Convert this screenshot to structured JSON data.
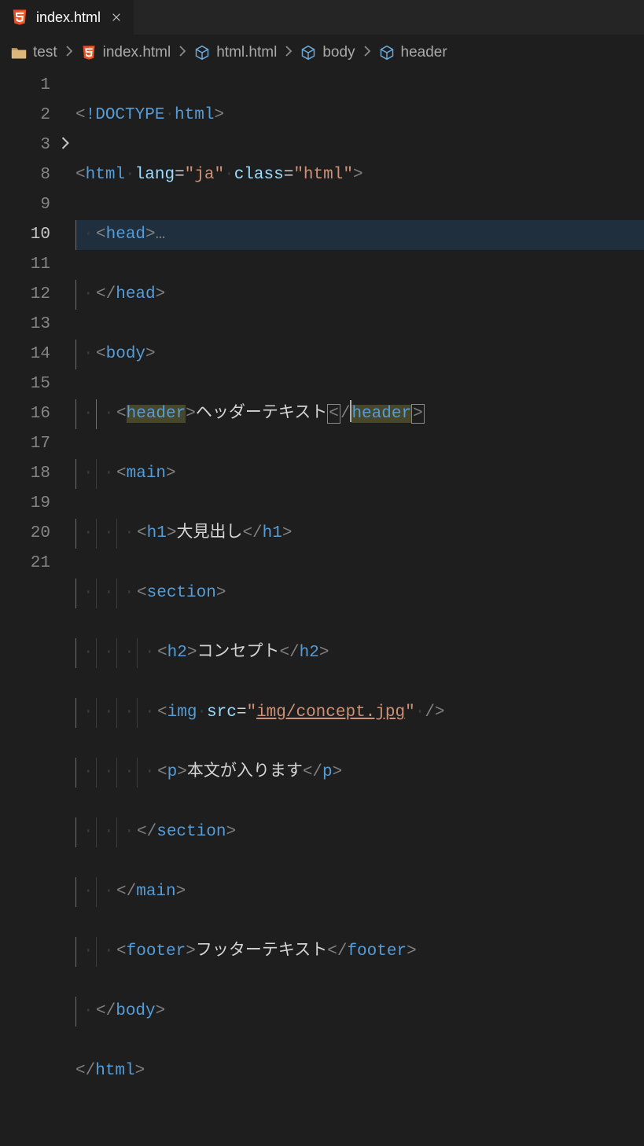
{
  "tab": {
    "filename": "index.html"
  },
  "breadcrumbs": {
    "items": [
      {
        "label": "test"
      },
      {
        "label": "index.html"
      },
      {
        "label": "html.html"
      },
      {
        "label": "body"
      },
      {
        "label": "header"
      }
    ]
  },
  "gutter": {
    "lines": [
      "1",
      "2",
      "3",
      "8",
      "9",
      "10",
      "11",
      "12",
      "13",
      "14",
      "15",
      "16",
      "17",
      "18",
      "19",
      "20",
      "21"
    ],
    "current": "10"
  },
  "code": {
    "l1_doctype": "!DOCTYPE",
    "l1_html": "html",
    "l2_tag": "html",
    "l2_attr1": "lang",
    "l2_val1": "\"ja\"",
    "l2_attr2": "class",
    "l2_val2": "\"html\"",
    "l3_tag": "head",
    "l3_folded": "…",
    "l8_tag": "head",
    "l9_tag": "body",
    "l10_tag": "header",
    "l10_text": "ヘッダーテキスト",
    "l11_tag": "main",
    "l12_tag": "h1",
    "l12_text": "大見出し",
    "l13_tag": "section",
    "l14_tag": "h2",
    "l14_text": "コンセプト",
    "l15_tag": "img",
    "l15_attr": "src",
    "l15_q1": "\"",
    "l15_val": "img/concept.jpg",
    "l15_q2": "\"",
    "l16_tag": "p",
    "l16_text": "本文が入ります",
    "l17_tag": "section",
    "l18_tag": "main",
    "l19_tag": "footer",
    "l19_text": "フッターテキスト",
    "l20_tag": "body",
    "l21_tag": "html"
  }
}
